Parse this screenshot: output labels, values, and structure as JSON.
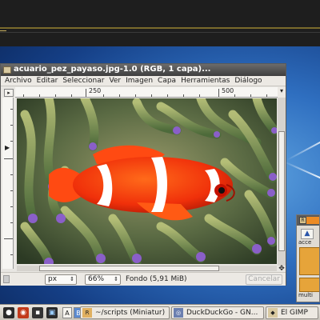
{
  "window": {
    "title": "acuario_pez_payaso.jpg-1.0 (RGB, 1 capa)..."
  },
  "menu": {
    "items": [
      "Archivo",
      "Editar",
      "Seleccionar",
      "Ver",
      "Imagen",
      "Capa",
      "Herramientas",
      "Diálogo"
    ]
  },
  "ruler": {
    "h_labels": [
      "250",
      "500"
    ]
  },
  "statusbar": {
    "units": "px",
    "zoom": "66%",
    "status": "Fondo (5,91 MiB)",
    "cancel": "Cancelar"
  },
  "toolbox": {
    "label1": "acce",
    "label2": "multi"
  },
  "taskbar": {
    "ws1": "A",
    "ws2": "B",
    "tasks": [
      "~/scripts (Miniatur)",
      "DuckDuckGo - GN...",
      "El GIMP"
    ]
  },
  "colors": {
    "title_gradient_top": "#6b6b6b",
    "title_gradient_bottom": "#3e3e3e",
    "desktop": "#2f6fc0",
    "fish": "#ff3b10"
  },
  "icons": [
    "gimp-icon",
    "menu-arrow-icon",
    "move-icon",
    "scroll-down-icon",
    "folder-icon",
    "up-arrow-icon",
    "firefox-icon",
    "penguin-icon",
    "terminal-icon"
  ]
}
